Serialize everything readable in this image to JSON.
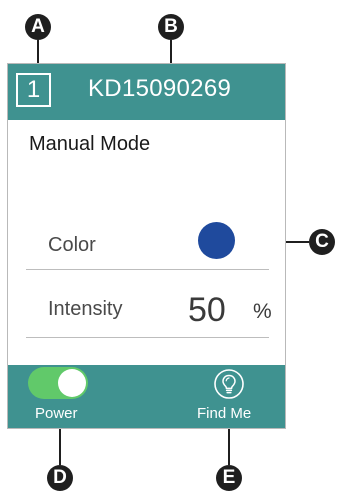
{
  "callouts": {
    "a": "A",
    "b": "B",
    "c": "C",
    "d": "D",
    "e": "E"
  },
  "header": {
    "channel": "1",
    "device_id": "KD15090269"
  },
  "main": {
    "mode_title": "Manual Mode",
    "color": {
      "label": "Color",
      "value_hex": "#1f4a9d"
    },
    "intensity": {
      "label": "Intensity",
      "value": "50",
      "unit": "%"
    }
  },
  "footer": {
    "power": {
      "label": "Power",
      "state": "on"
    },
    "find_me": {
      "label": "Find Me",
      "icon": "lightbulb-icon"
    }
  },
  "colors": {
    "bar": "#3f9290",
    "toggle_on": "#61c96a",
    "swatch": "#1f4a9d"
  }
}
